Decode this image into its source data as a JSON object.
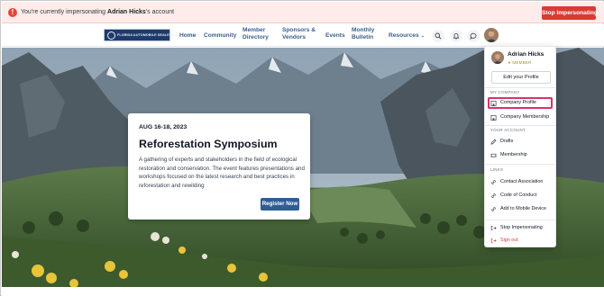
{
  "impersonation": {
    "message_prefix": "You're currently impersonating",
    "user_name": "Adrian Hicks",
    "message_suffix": "'s account",
    "stop_button": "Stop Impersonating"
  },
  "nav": {
    "logo_text": "FLORIDA AUTOMOBILE DEALERS ASSOCIATION",
    "items": [
      {
        "line1": "Home",
        "line2": ""
      },
      {
        "line1": "Community",
        "line2": ""
      },
      {
        "line1": "Member",
        "line2": "Directory"
      },
      {
        "line1": "Sponsors &",
        "line2": "Vendors"
      },
      {
        "line1": "Events",
        "line2": ""
      },
      {
        "line1": "Monthly",
        "line2": "Bulletin"
      },
      {
        "line1": "Resources",
        "line2": ""
      }
    ],
    "icons": [
      "search-icon",
      "bell-icon",
      "chat-icon"
    ]
  },
  "event": {
    "date": "AUG 16-18, 2023",
    "title": "Reforestation Symposium",
    "description": "A gathering of experts and stakeholders in the field of ecological restoration and conservation. The event features presentations and workshops focused on the latest research and best practices in reforestation and rewilding",
    "register_label": "Register Now"
  },
  "profile_menu": {
    "name": "Adrian Hicks",
    "role": "MEMBER",
    "edit_profile": "Edit your Profile",
    "sections": [
      {
        "title": "MY COMPANY",
        "items": [
          {
            "label": "Company Profile",
            "icon": "building-icon"
          },
          {
            "label": "Company Membership",
            "icon": "building-icon"
          }
        ]
      },
      {
        "title": "YOUR ACCOUNT",
        "items": [
          {
            "label": "Drafts",
            "icon": "pencil-icon"
          },
          {
            "label": "Membership",
            "icon": "ticket-icon"
          }
        ]
      },
      {
        "title": "LINKS",
        "items": [
          {
            "label": "Contact Association",
            "icon": "link-icon"
          },
          {
            "label": "Code of Conduct",
            "icon": "link-icon"
          },
          {
            "label": "Add to Mobile Device",
            "icon": "link-icon"
          }
        ]
      }
    ],
    "stop_impersonating": "Stop Impersonating",
    "sign_out": "Sign out",
    "colors": {
      "highlight": "#d6336c",
      "danger": "#d93b34",
      "role": "#a58a35"
    }
  }
}
